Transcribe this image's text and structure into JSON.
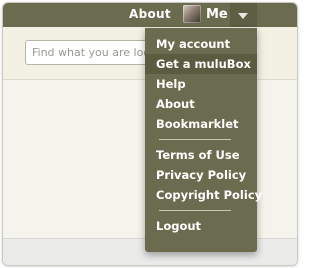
{
  "header": {
    "about_label": "About",
    "me_label": "Me",
    "avatar_icon": "user-avatar",
    "menu_toggle_icon": "caret-down-icon"
  },
  "search": {
    "placeholder": "Find what you are looking for"
  },
  "dropdown": {
    "groups": [
      [
        {
          "label": "My account"
        },
        {
          "label": "Get a muluBox",
          "highlighted": true
        },
        {
          "label": "Help"
        },
        {
          "label": "About"
        },
        {
          "label": "Bookmarklet"
        }
      ],
      [
        {
          "label": "Terms of Use"
        },
        {
          "label": "Privacy Policy"
        },
        {
          "label": "Copyright Policy"
        }
      ],
      [
        {
          "label": "Logout"
        }
      ]
    ]
  },
  "colors": {
    "bar": "#6b6c4f",
    "menu_hover": "#5a5b41",
    "page_bg": "#f5f4ec"
  }
}
